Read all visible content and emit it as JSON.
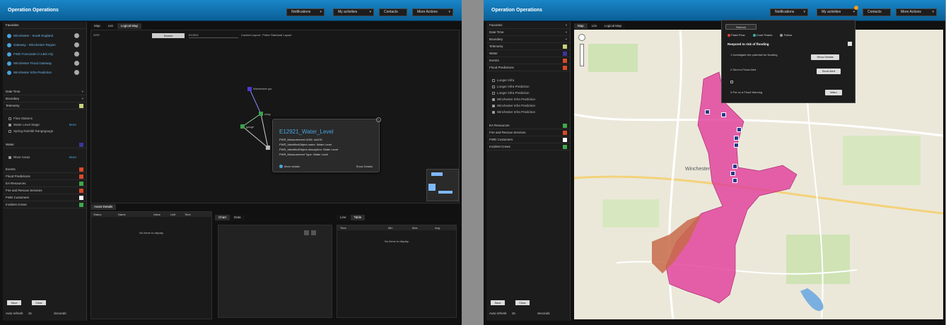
{
  "left_screen": {
    "app_title": "Operation Operations",
    "toolbar": [
      "Notifications",
      "My activities",
      "Contacts",
      "More Actions"
    ],
    "sidebar": {
      "favourites_title": "Favorites",
      "favourites": [
        "Winchester - South England",
        "Gateway - Winchester Region",
        "FWD Forecaster in LBG HQ",
        "Winchester Flood Gateway",
        "Winchester Infra Prediction"
      ],
      "rows_top": [
        "Date Time",
        "Boundary",
        "Telemetry"
      ],
      "checks": [
        "Flow Stations",
        "Water Level Stage",
        "Spring Rainfall Rangegauge"
      ],
      "more_label": "More",
      "weather_label": "Water",
      "river_level": "River Areas",
      "rows_bottom": [
        "Events",
        "Flood Predictions",
        "EA Resources",
        "Fire and Rescue Services",
        "FWD Customers",
        "Incident Crews"
      ],
      "buttons": [
        "Save",
        "Clear"
      ],
      "auto_refresh_label": "Auto refresh",
      "auto_refresh_value": "15",
      "auto_refresh_unit": "Seconds"
    },
    "tabs": [
      "Map",
      "List",
      "Logical Map"
    ],
    "search_row": {
      "left_value": "SITE",
      "search_button": "Search",
      "id_value": "E12921",
      "layout_label": "Context Layout : Potter Standard Layout"
    },
    "graph_nodes": [
      "Winchester gw",
      "gauge",
      "relay",
      "E12921"
    ],
    "tooltip": {
      "title": "E12921_Water_Level",
      "rows": [
        {
          "k": "PWR_Measurement UOM:",
          "v": "mAOD"
        },
        {
          "k": "PWR_IdentifiedObject.name:",
          "v": "Water Level"
        },
        {
          "k": "PWR_IdentifiedObject.description:",
          "v": "Water Level"
        },
        {
          "k": "PWR_Measurement Type:",
          "v": "Water Level"
        }
      ],
      "link_left": "More details",
      "link_right": "Show Details"
    },
    "bottom_tab": "Asset Details",
    "asset_cols": [
      "Status",
      "Name",
      "Value",
      "Unit",
      "Time"
    ],
    "no_items": "No items to display",
    "mid_tabs": [
      "Chart",
      "Data"
    ],
    "right_tabs": [
      "Line",
      "Table"
    ],
    "right_cols": [
      "Time",
      "Min",
      "Max",
      "Avg"
    ]
  },
  "right_screen": {
    "app_title": "Operation Operations",
    "toolbar": [
      "Notifications",
      "My activities",
      "Contacts",
      "More Actions"
    ],
    "tabs": [
      "Map",
      "List",
      "Logical Map"
    ],
    "sidebar": {
      "rows_top": [
        "Favorites",
        "Date Time",
        "Boundary",
        "Telemetry",
        "Water",
        "Events",
        "Flood Predictions"
      ],
      "checks": [
        "Longer Infra",
        "Longer Infra Prediction",
        "Longer Infra Prediction",
        "Winchester Infra Prediction",
        "Winchester Infra Prediction",
        "Winchester Infra Prediction"
      ],
      "rows_bottom": [
        "EA Resources",
        "Fire and Rescue Services",
        "FWD Customers",
        "Incident Crews"
      ],
      "buttons": [
        "Save",
        "Clear"
      ],
      "auto_refresh_label": "Auto refresh",
      "auto_refresh_value": "15",
      "auto_refresh_unit": "Seconds"
    },
    "dropdown": {
      "title_button": "Refresh",
      "options": [
        "Flash Flow",
        "Court Teams",
        "Follow"
      ],
      "section_title": "Respond to risk of flooding",
      "steps": [
        {
          "text": "1 Investigate the potential for flooding",
          "button": "Show Details"
        },
        {
          "text": "2 Send a Flood Alert",
          "button": "Send Alert"
        },
        {
          "text": "3 Put on a Flood Warning",
          "button": "Warn"
        }
      ]
    },
    "map_label": "Winchester",
    "colors": {
      "flood": "#e0409a",
      "brand": "#0d72b0",
      "accent": "#4aa3df"
    }
  }
}
